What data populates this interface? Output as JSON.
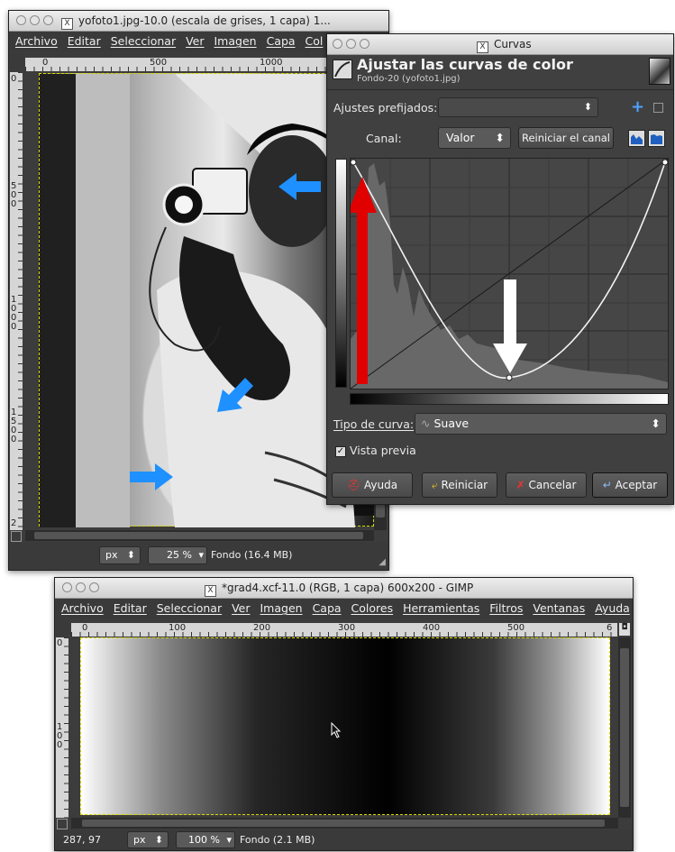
{
  "image_window": {
    "title": "yofoto1.jpg-10.0 (escala de grises, 1 capa) 1...",
    "menu": [
      "Archivo",
      "Editar",
      "Seleccionar",
      "Ver",
      "Imagen",
      "Capa",
      "Col"
    ],
    "hruler_labels": [
      "0",
      "500",
      "1000"
    ],
    "vruler_labels": [
      "0",
      "500",
      "1000",
      "1500",
      "2"
    ],
    "status": {
      "unit": "px",
      "zoom": "25 %",
      "layer_info": "Fondo (16.4 MB)"
    }
  },
  "curves_dialog": {
    "title": "Curvas",
    "heading": "Ajustar las curvas de color",
    "subheading": "Fondo-20 (yofoto1.jpg)",
    "presets_label": "Ajustes prefijados:",
    "channel_label": "Canal:",
    "channel_value": "Valor",
    "reset_channel_label": "Reiniciar el canal",
    "curve_type_label": "Tipo de curva:",
    "curve_type_value": "Suave",
    "preview_label": "Vista previa",
    "preview_checked": true,
    "buttons": {
      "help": "Ayuda",
      "reset": "Reiniciar",
      "cancel": "Cancelar",
      "ok": "Aceptar"
    },
    "colors": {
      "red_arrow": "#e00000",
      "white_arrow": "#ffffff"
    }
  },
  "gradient_window": {
    "title": "*grad4.xcf-11.0 (RGB, 1 capa) 600x200 - GIMP",
    "menu": [
      "Archivo",
      "Editar",
      "Seleccionar",
      "Ver",
      "Imagen",
      "Capa",
      "Colores",
      "Herramientas",
      "Filtros",
      "Ventanas",
      "Ayuda"
    ],
    "hruler_labels": [
      "0",
      "100",
      "200",
      "300",
      "400",
      "500",
      "6"
    ],
    "vruler_labels": [
      "0",
      "100"
    ],
    "status": {
      "coords": "287, 97",
      "unit": "px",
      "zoom": "100 %",
      "layer_info": "Fondo (2.1 MB)"
    }
  },
  "annotation_arrow_color": "#1e90ff"
}
